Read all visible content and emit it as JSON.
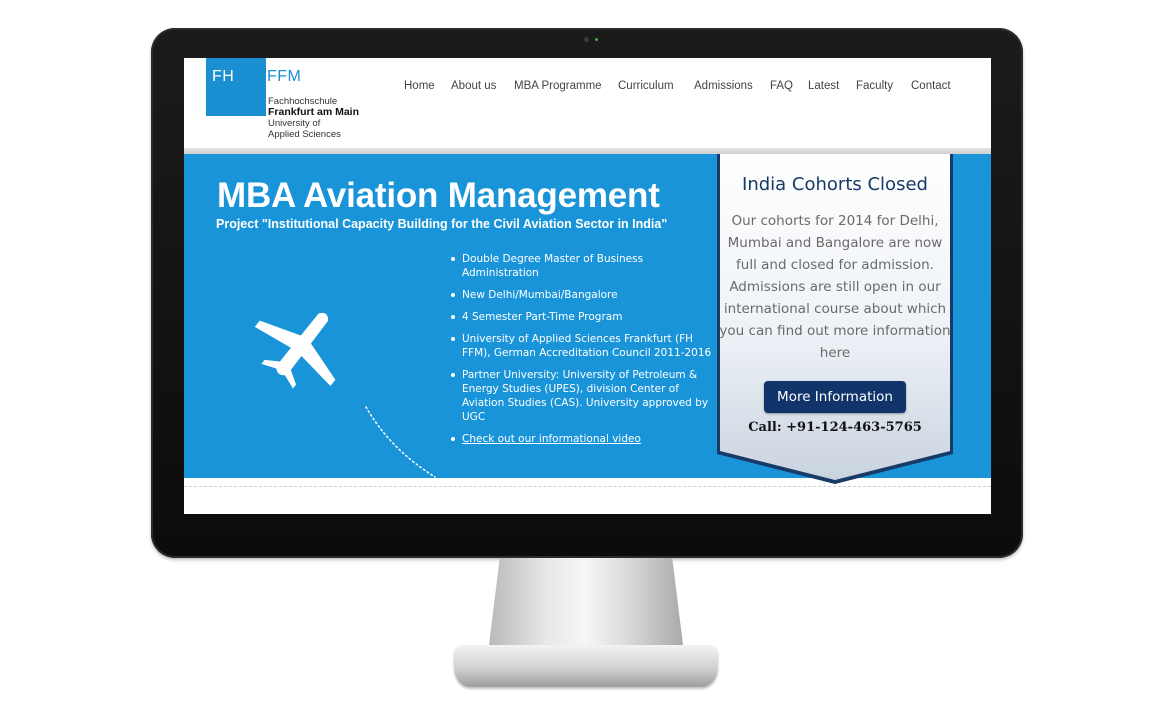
{
  "logo": {
    "fh": "FH",
    "ffm": "FFM",
    "line1": "Fachhochschule",
    "line2": "Frankfurt am Main",
    "line3": "University of",
    "line4": "Applied Sciences"
  },
  "nav": {
    "items": [
      {
        "label": "Home"
      },
      {
        "label": "About us"
      },
      {
        "label": "MBA Programme"
      },
      {
        "label": "Curriculum"
      },
      {
        "label": "Admissions"
      },
      {
        "label": "FAQ"
      },
      {
        "label": "Latest"
      },
      {
        "label": "Faculty"
      },
      {
        "label": "Contact"
      }
    ]
  },
  "hero": {
    "title": "MBA Aviation Management",
    "subtitle": "Project \"Institutional Capacity Building for the Civil Aviation Sector in India\"",
    "bullets": [
      "Double Degree Master of Business Administration",
      "New Delhi/Mumbai/Bangalore",
      "4 Semester Part-Time Program",
      "University of Applied Sciences Frankfurt (FH FFM), German Accreditation Council 2011-2016",
      "Partner University: University of Petroleum & Energy Studies (UPES), division Center of Aviation Studies (CAS). University approved by UGC"
    ],
    "video_link": "Check out our informational video"
  },
  "banner": {
    "title": "India Cohorts Closed",
    "body": "Our cohorts for 2014 for Delhi, Mumbai and Bangalore are now full and closed for admission. Admissions are still open in our international course about which you can find out more information here",
    "button": "More Information",
    "call": "Call: +91-124-463-5765"
  },
  "colors": {
    "brand_blue": "#1a94d9",
    "navy": "#11356a",
    "banner_title": "#173a66"
  },
  "icons": {
    "plane": "airplane-icon"
  }
}
